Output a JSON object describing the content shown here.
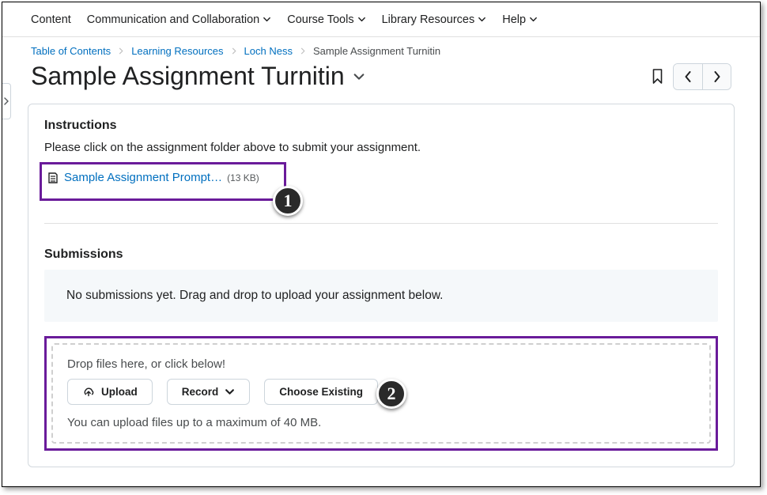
{
  "topnav": {
    "items": [
      {
        "label": "Content",
        "has_dropdown": false
      },
      {
        "label": "Communication and Collaboration",
        "has_dropdown": true
      },
      {
        "label": "Course Tools",
        "has_dropdown": true
      },
      {
        "label": "Library Resources",
        "has_dropdown": true
      },
      {
        "label": "Help",
        "has_dropdown": true
      }
    ]
  },
  "breadcrumb": {
    "items": [
      {
        "label": "Table of Contents",
        "link": true
      },
      {
        "label": "Learning Resources",
        "link": true
      },
      {
        "label": "Loch Ness",
        "link": true
      },
      {
        "label": "Sample Assignment Turnitin",
        "link": false
      }
    ]
  },
  "page_title": "Sample Assignment Turnitin",
  "instructions": {
    "heading": "Instructions",
    "body": "Please click on the assignment folder above to submit your assignment.",
    "attachment": {
      "name": "Sample Assignment Prompt…",
      "size": "(13 KB)"
    }
  },
  "submissions": {
    "heading": "Submissions",
    "empty_text": "No submissions yet. Drag and drop to upload your assignment below."
  },
  "uploader": {
    "drop_text": "Drop files here, or click below!",
    "upload_label": "Upload",
    "record_label": "Record",
    "choose_label": "Choose Existing",
    "limit_text": "You can upload files up to a maximum of 40 MB."
  },
  "annotations": {
    "badge1": "1",
    "badge2": "2"
  }
}
